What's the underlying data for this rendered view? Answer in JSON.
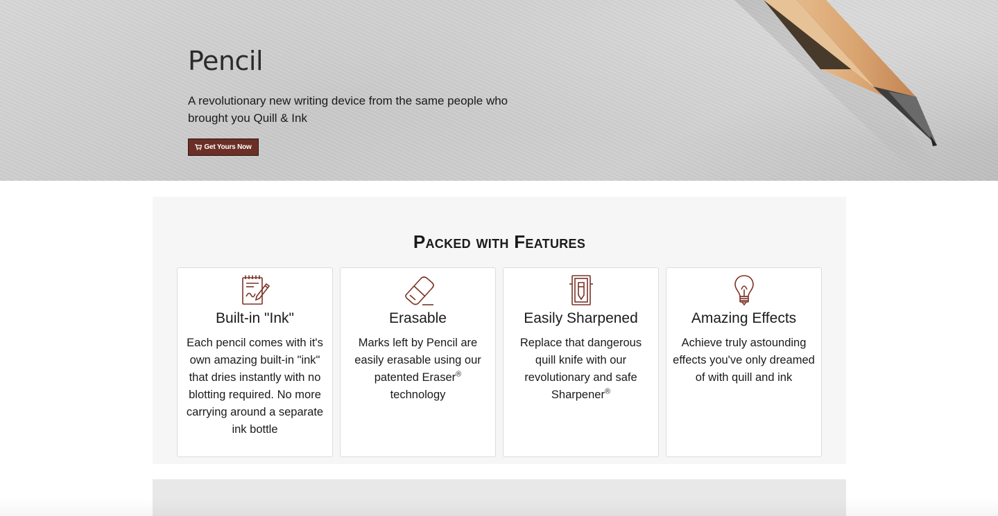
{
  "hero": {
    "title": "Pencil",
    "subtitle": "A revolutionary new writing device from the same people who brought you Quill & Ink",
    "cta_label": "Get Yours Now",
    "cta_icon": "shopping-cart-icon"
  },
  "features": {
    "title": "Packed with Features",
    "cards": [
      {
        "icon": "notepad-pencil-icon",
        "title": "Built-in \"Ink\"",
        "text": "Each pencil comes with it's own amazing built-in \"ink\" that dries instantly with no blotting required. No more carrying around a separate ink bottle"
      },
      {
        "icon": "eraser-icon",
        "title": "Erasable",
        "text": "Marks left by Pencil are easily erasable using our patented Eraser",
        "mark": "®",
        "text_after": "technology"
      },
      {
        "icon": "sharpener-icon",
        "title": "Easily Sharpened",
        "text": "Replace that dangerous quill knife with our revolutionary and safe Sharpener",
        "mark": "®"
      },
      {
        "icon": "lightbulb-icon",
        "title": "Amazing Effects",
        "text": "Achieve truly astounding effects you've only dreamed of with quill and ink"
      }
    ]
  },
  "colors": {
    "accent": "#6b2f26",
    "icon_stroke": "#7a3226",
    "features_bg": "#f6f6f6"
  }
}
